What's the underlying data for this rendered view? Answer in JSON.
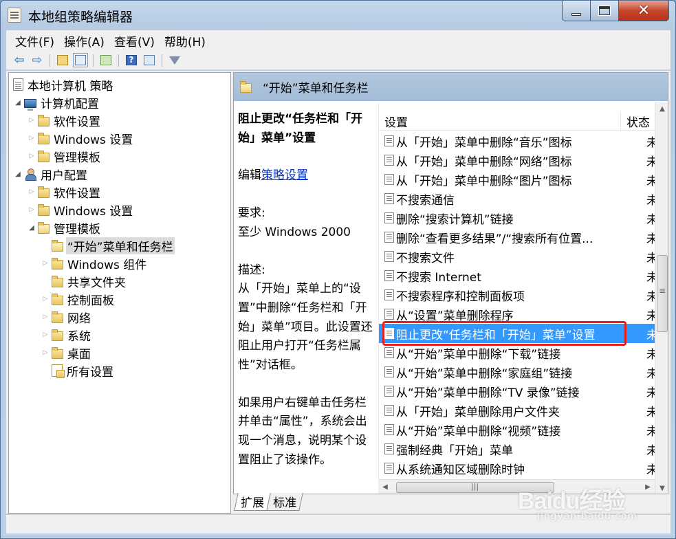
{
  "window": {
    "title": "本地组策略编辑器",
    "controls": {
      "minimize": "minimize",
      "maximize": "maximize",
      "close": "✕"
    }
  },
  "menu": [
    "文件(F)",
    "操作(A)",
    "查看(V)",
    "帮助(H)"
  ],
  "toolbar": {
    "icons": [
      "back-arrow-icon",
      "forward-arrow-icon",
      "up-folder-icon",
      "show-hide-tree-icon",
      "export-list-icon",
      "help-icon",
      "properties-icon",
      "filter-icon"
    ]
  },
  "tree": {
    "root": "本地计算机 策略",
    "computer": "计算机配置",
    "computer_children": [
      "软件设置",
      "Windows 设置",
      "管理模板"
    ],
    "user": "用户配置",
    "user_children": [
      "软件设置",
      "Windows 设置",
      "管理模板"
    ],
    "admin_templates_children": [
      "“开始”菜单和任务栏",
      "Windows 组件",
      "共享文件夹",
      "控制面板",
      "网络",
      "系统",
      "桌面",
      "所有设置"
    ],
    "selected": "“开始”菜单和任务栏"
  },
  "detail": {
    "header_title": "“开始”菜单和任务栏",
    "policy_title": "阻止更改“任务栏和「开始」菜单”设置",
    "edit_prefix": "编辑",
    "edit_link": "策略设置",
    "requirement_label": "要求:",
    "requirement_value": "至少 Windows 2000",
    "description_label": "描述:",
    "description_1": "从「开始」菜单上的“设置”中删除“任务栏和「开始」菜单”项目。此设置还阻止用户打开“任务栏属性”对话框。",
    "description_2": "如果用户右键单击任务栏并单击“属性”，系统会出现一个消息，说明某个设置阻止了该操作。"
  },
  "list": {
    "col_setting": "设置",
    "col_state": "状态",
    "rows": [
      {
        "name": "从「开始」菜单中删除“音乐”图标",
        "state": "未配置"
      },
      {
        "name": "从「开始」菜单中删除“网络”图标",
        "state": "未配置"
      },
      {
        "name": "从「开始」菜单中删除“图片”图标",
        "state": "未配置"
      },
      {
        "name": "不搜索通信",
        "state": "未配置"
      },
      {
        "name": "删除“搜索计算机”链接",
        "state": "未配置"
      },
      {
        "name": "删除“查看更多结果”/“搜索所有位置...",
        "state": "未配置"
      },
      {
        "name": "不搜索文件",
        "state": "未配置"
      },
      {
        "name": "不搜索 Internet",
        "state": "未配置"
      },
      {
        "name": "不搜索程序和控制面板项",
        "state": "未配置"
      },
      {
        "name": "从“设置”菜单删除程序",
        "state": "未配置"
      },
      {
        "name": "阻止更改“任务栏和「开始」菜单”设置",
        "state": "未配置"
      },
      {
        "name": "从“开始”菜单中删除“下载”链接",
        "state": "未配置"
      },
      {
        "name": "从“开始”菜单中删除“家庭组”链接",
        "state": "未配置"
      },
      {
        "name": "从“开始”菜单中删除“TV 录像”链接",
        "state": "未配置"
      },
      {
        "name": "从「开始」菜单删除用户文件夹",
        "state": "未配置"
      },
      {
        "name": "从“开始”菜单中删除“视频”链接",
        "state": "未配置"
      },
      {
        "name": "强制经典「开始」菜单",
        "state": "未配置"
      },
      {
        "name": "从系统通知区域删除时钟",
        "state": "未配置"
      }
    ],
    "selected_index": 10,
    "highlight_color": "#e8201a",
    "selection_color": "#3399ff"
  },
  "tabs": [
    "扩展",
    "标准"
  ],
  "active_tab": "扩展",
  "watermark": {
    "logo": "Baidu经验",
    "url": "jingyan.baidu.com"
  }
}
